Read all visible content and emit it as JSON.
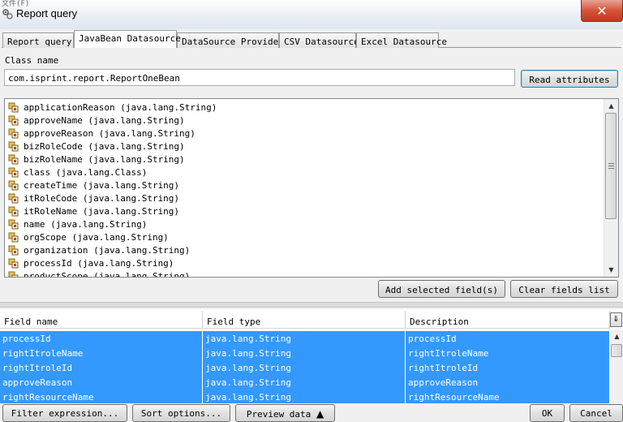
{
  "window": {
    "title": "Report query",
    "menu_stub": "文件(F)",
    "close_symbol": "✕"
  },
  "tabs": [
    {
      "label": "Report query",
      "active": false
    },
    {
      "label": "JavaBean Datasource",
      "active": true
    },
    {
      "label": "DataSource Provider",
      "active": false
    },
    {
      "label": "CSV Datasource",
      "active": false
    },
    {
      "label": "Excel Datasource",
      "active": false
    }
  ],
  "class_name": {
    "label": "Class name",
    "value": "com.isprint.report.ReportOneBean"
  },
  "read_button": "Read attributes",
  "attributes": [
    "applicationReason (java.lang.String)",
    "approveName (java.lang.String)",
    "approveReason (java.lang.String)",
    "bizRoleCode (java.lang.String)",
    "bizRoleName (java.lang.String)",
    "class (java.lang.Class)",
    "createTime (java.lang.String)",
    "itRoleCode (java.lang.String)",
    "itRoleName (java.lang.String)",
    "name (java.lang.String)",
    "orgScope (java.lang.String)",
    "organization (java.lang.String)",
    "processId (java.lang.String)",
    "productScope (java.lang.String)"
  ],
  "attribute_icon": "bean-property-icon",
  "add_button": "Add selected field(s)",
  "clear_button": "Clear fields list",
  "fields_table": {
    "columns": [
      "Field name",
      "Field type",
      "Description"
    ],
    "rows": [
      [
        "processId",
        "java.lang.String",
        "processId"
      ],
      [
        "rightItroleName",
        "java.lang.String",
        "rightItroleName"
      ],
      [
        "rightItroleId",
        "java.lang.String",
        "rightItroleId"
      ],
      [
        "approveReason",
        "java.lang.String",
        "approveReason"
      ],
      [
        "rightResourceName",
        "java.lang.String",
        "rightResourceName"
      ]
    ],
    "corner_icon": "column-chooser-icon"
  },
  "bottom_buttons": {
    "filter": "Filter expression...",
    "sort": "Sort options...",
    "preview": "Preview data",
    "ok": "OK",
    "cancel": "Cancel"
  },
  "colors": {
    "selection": "#3399ff",
    "close_button": "#c8452a"
  }
}
